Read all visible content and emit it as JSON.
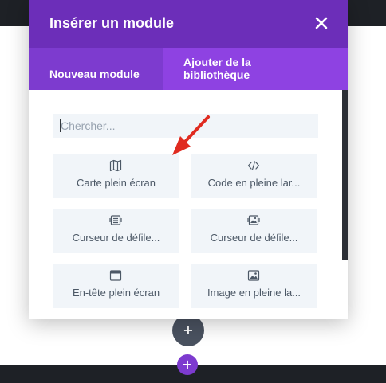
{
  "modal": {
    "title": "Insérer un module",
    "close_icon": "close-icon"
  },
  "tabs": [
    {
      "label": "Nouveau module",
      "active": true
    },
    {
      "label": "Ajouter de la bibliothèque",
      "active": false
    }
  ],
  "search": {
    "placeholder": "Chercher...",
    "value": ""
  },
  "modules": [
    {
      "label": "Carte plein écran",
      "icon": "map-icon"
    },
    {
      "label": "Code en pleine lar...",
      "icon": "code-icon"
    },
    {
      "label": "Curseur de défile...",
      "icon": "slider-icon"
    },
    {
      "label": "Curseur de défile...",
      "icon": "post-slider-icon"
    },
    {
      "label": "En-tête plein écran",
      "icon": "header-icon"
    },
    {
      "label": "Image en pleine la...",
      "icon": "image-icon"
    },
    {
      "label": "",
      "icon": "menu-icon"
    },
    {
      "label": "",
      "icon": "table-icon"
    }
  ],
  "page": {
    "add_section_label": "+",
    "add_row_label": "+"
  },
  "colors": {
    "header_purple": "#6c2eb9",
    "tab_bar_purple": "#8e42e2",
    "active_tab_purple": "#7d3bcf",
    "card_bg": "#f1f5f9",
    "arrow_red": "#e02b20"
  }
}
